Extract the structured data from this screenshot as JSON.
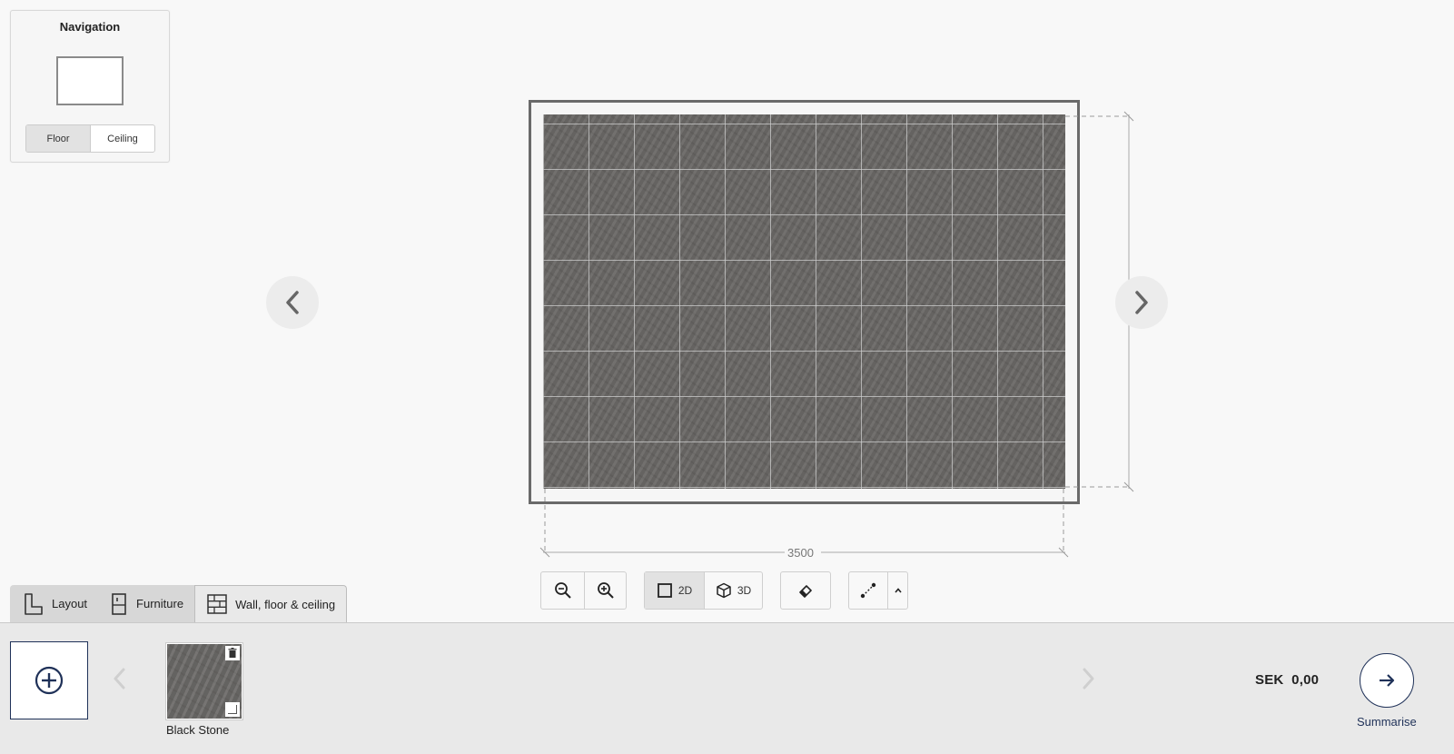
{
  "navigation": {
    "title": "Navigation",
    "segments": [
      {
        "label": "Floor",
        "active": true
      },
      {
        "label": "Ceiling",
        "active": false
      }
    ]
  },
  "canvas": {
    "dimension_label": "3500"
  },
  "toolbar": {
    "view_2d_label": "2D",
    "view_3d_label": "3D",
    "active_view": "2D"
  },
  "tabs": [
    {
      "label": "Layout",
      "icon": "layout-icon",
      "active": false
    },
    {
      "label": "Furniture",
      "icon": "furniture-icon",
      "active": false
    },
    {
      "label": "Wall, floor & ceiling",
      "icon": "tiles-icon",
      "active": true
    }
  ],
  "materials": [
    {
      "name": "Black Stone"
    }
  ],
  "summary": {
    "price": "SEK  0,00",
    "button_label": "Summarise"
  },
  "colors": {
    "accent": "#1f3158",
    "floor_tile": "#6a6866"
  }
}
